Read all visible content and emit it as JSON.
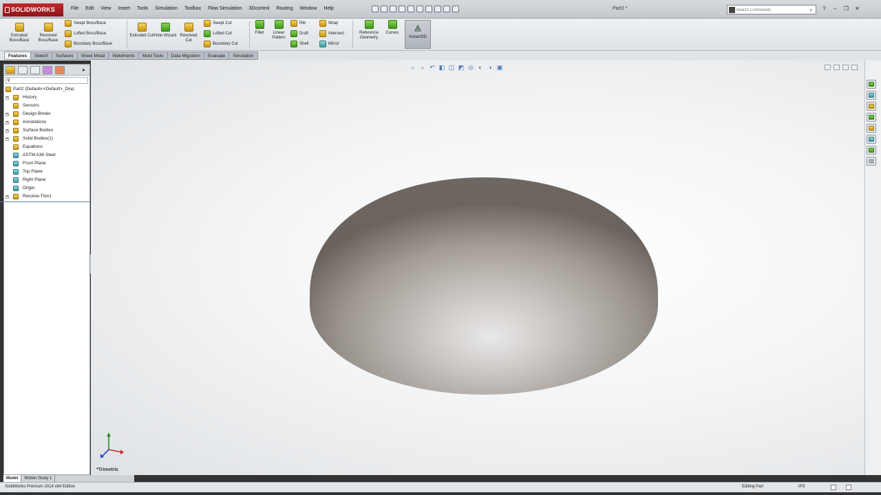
{
  "app": {
    "logo_text": "SOLIDWORKS",
    "document_title": "Part2 *"
  },
  "menu": [
    "File",
    "Edit",
    "View",
    "Insert",
    "Tools",
    "Simulation",
    "Toolbox",
    "Flow Simulation",
    "3Dcontrol",
    "Routing",
    "Window",
    "Help"
  ],
  "search": {
    "placeholder": "Search Commands"
  },
  "features_toolbar": {
    "extruded_boss": "Extruded Boss/Base",
    "revolved_boss": "Revolved Boss/Base",
    "swept_boss": "Swept Boss/Base",
    "lofted_boss": "Lofted Boss/Base",
    "boundary_boss": "Boundary Boss/Base",
    "extruded_cut": "Extruded Cut",
    "hole_wizard": "Hole Wizard",
    "revolved_cut": "Revolved Cut",
    "swept_cut": "Swept Cut",
    "lofted_cut": "Lofted Cut",
    "boundary_cut": "Boundary Cut",
    "fillet": "Fillet",
    "linear_pattern": "Linear Pattern",
    "rib": "Rib",
    "draft": "Draft",
    "shell": "Shell",
    "wrap": "Wrap",
    "intersect": "Intersect",
    "mirror": "Mirror",
    "reference_geometry": "Reference Geometry",
    "curves": "Curves",
    "instant3d": "Instant3D"
  },
  "tabs": [
    "Features",
    "Sketch",
    "Surfaces",
    "Sheet Metal",
    "Weldments",
    "Mold Tools",
    "Data Migration",
    "Evaluate",
    "Simulation"
  ],
  "tree": {
    "root": "Part2  (Default<<Default>_Disp",
    "items": [
      {
        "label": "History",
        "icon": "folder-icon",
        "expandable": true
      },
      {
        "label": "Sensors",
        "icon": "sensor-icon",
        "expandable": false
      },
      {
        "label": "Design Binder",
        "icon": "binder-icon",
        "expandable": true
      },
      {
        "label": "Annotations",
        "icon": "annotations-icon",
        "expandable": true
      },
      {
        "label": "Surface Bodies",
        "icon": "surface-bodies-icon",
        "expandable": true
      },
      {
        "label": "Solid Bodies(1)",
        "icon": "solid-bodies-icon",
        "expandable": true
      },
      {
        "label": "Equations",
        "icon": "equations-icon",
        "expandable": false
      },
      {
        "label": "ASTM A36 Steel",
        "icon": "material-icon",
        "expandable": false
      },
      {
        "label": "Front Plane",
        "icon": "plane-icon",
        "expandable": false
      },
      {
        "label": "Top Plane",
        "icon": "plane-icon",
        "expandable": false
      },
      {
        "label": "Right Plane",
        "icon": "plane-icon",
        "expandable": false
      },
      {
        "label": "Origin",
        "icon": "origin-icon",
        "expandable": false
      },
      {
        "label": "Revolve-Thin1",
        "icon": "revolve-icon",
        "expandable": true
      }
    ]
  },
  "bottom_tabs": [
    "Model",
    "Motion Study 1"
  ],
  "viewport": {
    "view_label": "*Trimetric"
  },
  "status": {
    "edition": "SolidWorks Premium 2014 x64 Edition",
    "mode": "Editing Part",
    "units": "IPS"
  },
  "colors": {
    "logo_red": "#b01e23",
    "viewport_bg": "#f4f5f6",
    "dome_mid": "#c9c2bd",
    "dome_dark": "#6e6660"
  }
}
